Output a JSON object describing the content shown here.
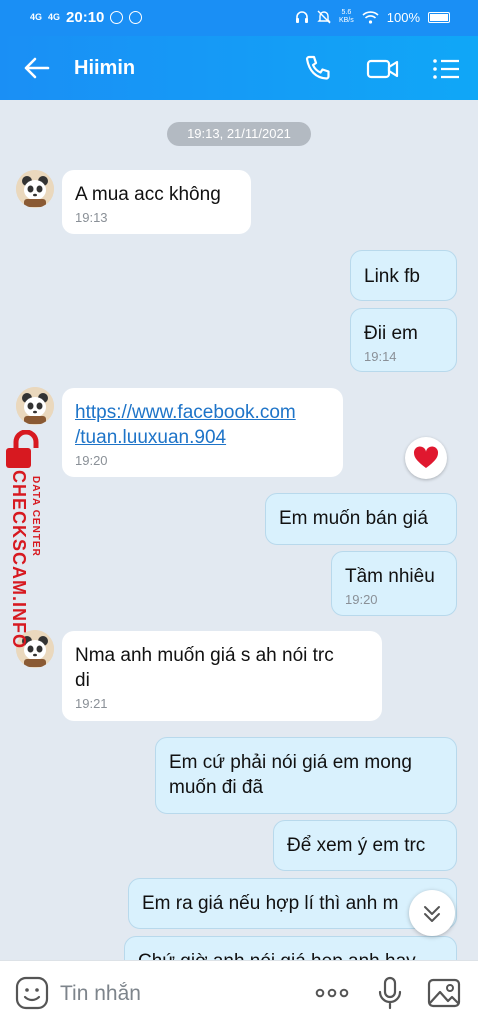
{
  "status_bar": {
    "signal1": "4G",
    "signal2": "4G",
    "time": "20:10",
    "net_speed_value": "5.6",
    "net_speed_unit": "KB/s",
    "battery": "100%"
  },
  "header": {
    "title": "Hiimin"
  },
  "chat": {
    "date_separator": "19:13, 21/11/2021",
    "messages": [
      {
        "text": "A mua acc không",
        "time": "19:13"
      },
      {
        "text": "Link fb"
      },
      {
        "text": "Đii em",
        "time": "19:14"
      },
      {
        "link_line1": "https://www.facebook.com",
        "link_line2": "/tuan.luuxuan.904",
        "time": "19:20"
      },
      {
        "text": "Em muốn bán giá"
      },
      {
        "text": "Tầm nhiêu",
        "time": "19:20"
      },
      {
        "line1": "Nma anh muốn giá s ah nói trc",
        "line2": "di",
        "time": "19:21"
      },
      {
        "line1": "Em cứ phải nói giá em mong",
        "line2": "muốn đi đã"
      },
      {
        "text": "Để xem ý em trc"
      },
      {
        "text": "Em ra giá nếu hợp lí thì anh m"
      },
      {
        "text": "Chứ giờ anh nói giá hẹp anh hay"
      }
    ]
  },
  "watermark": {
    "brand": "CHECKSCAM.INFO",
    "sub": "DATA CENTER"
  },
  "input_bar": {
    "placeholder": "Tin nhắn"
  },
  "colors": {
    "header_blue": "#1a8ff5",
    "outgoing_bubble": "#d9f1fd",
    "incoming_bubble": "#ffffff",
    "chat_bg": "#e2e9f1",
    "link": "#1e74c8",
    "watermark_red": "#d71920"
  }
}
